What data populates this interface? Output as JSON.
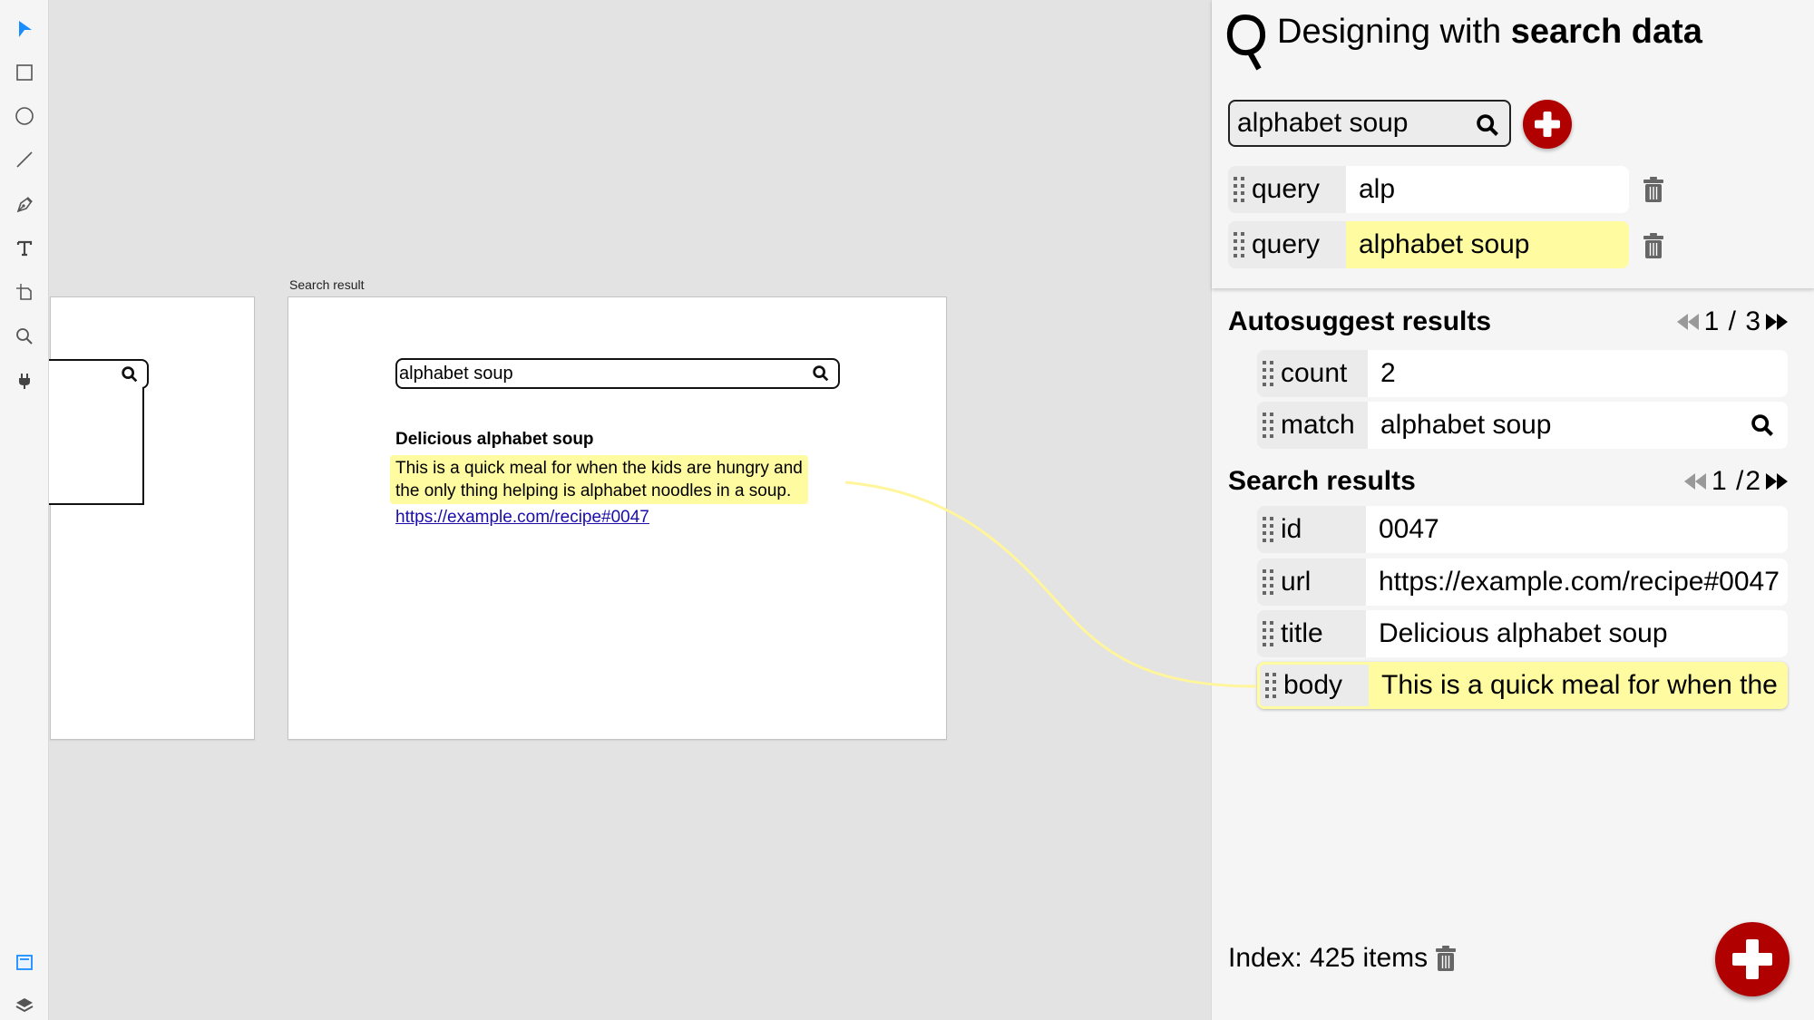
{
  "toolbar": {
    "tools": [
      {
        "name": "select-tool",
        "icon": "cursor-arrow-icon",
        "active": true
      },
      {
        "name": "rectangle-tool",
        "icon": "rectangle-icon"
      },
      {
        "name": "ellipse-tool",
        "icon": "circle-icon"
      },
      {
        "name": "line-tool",
        "icon": "line-icon"
      },
      {
        "name": "pen-tool",
        "icon": "pen-nib-icon"
      },
      {
        "name": "text-tool",
        "icon": "text-t-icon"
      },
      {
        "name": "artboard-tool",
        "icon": "artboard-icon"
      },
      {
        "name": "zoom-tool",
        "icon": "magnifier-icon"
      },
      {
        "name": "plugins-tool",
        "icon": "plug-icon"
      }
    ],
    "bottom_tools": [
      {
        "name": "assets-panel",
        "icon": "window-icon",
        "active": true
      },
      {
        "name": "layers-panel",
        "icon": "layers-icon"
      }
    ],
    "accent_color": "#1a8cff"
  },
  "canvas": {
    "artboard_label": "Search result",
    "search_value": "alphabet soup",
    "result_title": "Delicious alphabet soup",
    "result_body_line1": "This is a quick meal for when the kids are hungry and",
    "result_body_line2": "the only thing helping is alphabet noodles in a soup.",
    "result_link": "https://example.com/recipe#0047",
    "highlight_color": "#fffba0"
  },
  "panel": {
    "title_regular": "Designing with ",
    "title_bold": "search data",
    "search_value": "alphabet soup",
    "queries": [
      {
        "key": "query",
        "value": "alp",
        "highlighted": false
      },
      {
        "key": "query",
        "value": "alphabet soup",
        "highlighted": true
      }
    ],
    "autosuggest": {
      "title": "Autosuggest results",
      "page_current": "1",
      "page_sep": " / ",
      "page_total": "3",
      "fields": [
        {
          "key": "count",
          "value": "2"
        },
        {
          "key": "match",
          "value": "alphabet soup"
        }
      ]
    },
    "search_results": {
      "title": "Search results",
      "page_current": "1",
      "page_sep": " /",
      "page_total": "2",
      "fields": [
        {
          "key": "id",
          "value": "0047"
        },
        {
          "key": "url",
          "value": "https://example.com/recipe#0047"
        },
        {
          "key": "title",
          "value": "Delicious alphabet soup"
        },
        {
          "key": "body",
          "value": "This is a quick meal for when the kids are hungry and the only thing helping is alphabet noodles in a soup."
        }
      ]
    },
    "index_label": "Index: 425 items",
    "brand_color": "#b00000"
  }
}
